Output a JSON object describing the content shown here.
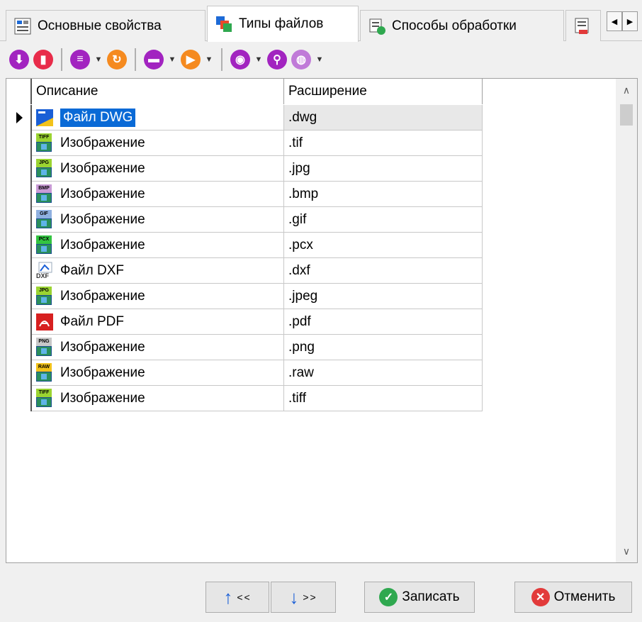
{
  "tabs": {
    "items": [
      {
        "label": "Основные свойства",
        "icon": "properties-icon"
      },
      {
        "label": "Типы файлов",
        "icon": "file-types-icon"
      },
      {
        "label": "Способы обработки",
        "icon": "processing-icon"
      }
    ],
    "active_index": 1
  },
  "toolbar": {
    "icons": [
      "add-icon",
      "delete-icon",
      "list-icon",
      "refresh-icon",
      "print-icon",
      "run-icon",
      "view-icon",
      "search-icon",
      "globe-icon"
    ]
  },
  "grid": {
    "columns": [
      "Описание",
      "Расширение"
    ],
    "selected_row": 0,
    "rows": [
      {
        "description": "Файл DWG",
        "extension": ".dwg",
        "icon": "dwg-icon"
      },
      {
        "description": "Изображение",
        "extension": ".tif",
        "icon": "image-icon",
        "tag": "TIFF",
        "tag_color": "#9bd431"
      },
      {
        "description": "Изображение",
        "extension": ".jpg",
        "icon": "image-icon",
        "tag": "JPG",
        "tag_color": "#9bd431"
      },
      {
        "description": "Изображение",
        "extension": ".bmp",
        "icon": "image-icon",
        "tag": "BMP",
        "tag_color": "#c99bd6"
      },
      {
        "description": "Изображение",
        "extension": ".gif",
        "icon": "image-icon",
        "tag": "GIF",
        "tag_color": "#8fb0e0"
      },
      {
        "description": "Изображение",
        "extension": ".pcx",
        "icon": "image-icon",
        "tag": "PCX",
        "tag_color": "#33c441"
      },
      {
        "description": "Файл DXF",
        "extension": ".dxf",
        "icon": "dxf-icon",
        "tag": "DXF"
      },
      {
        "description": "Изображение",
        "extension": ".jpeg",
        "icon": "image-icon",
        "tag": "JPG",
        "tag_color": "#9bd431"
      },
      {
        "description": "Файл PDF",
        "extension": ".pdf",
        "icon": "pdf-icon"
      },
      {
        "description": "Изображение",
        "extension": ".png",
        "icon": "image-icon",
        "tag": "PNG",
        "tag_color": "#c8c8c8"
      },
      {
        "description": "Изображение",
        "extension": ".raw",
        "icon": "image-icon",
        "tag": "RAW",
        "tag_color": "#f2c21a"
      },
      {
        "description": "Изображение",
        "extension": ".tiff",
        "icon": "image-icon",
        "tag": "TIFF",
        "tag_color": "#9bd431"
      }
    ]
  },
  "buttons": {
    "prev": "<<",
    "next": ">>",
    "save": "Записать",
    "cancel": "Отменить"
  },
  "colors": {
    "selection": "#0a6ad6",
    "save_icon": "#2fa84f",
    "cancel_icon": "#e23a3a",
    "toolbar_purple": "#a224c0",
    "toolbar_red": "#e82c4a",
    "toolbar_orange": "#f58a1f"
  }
}
